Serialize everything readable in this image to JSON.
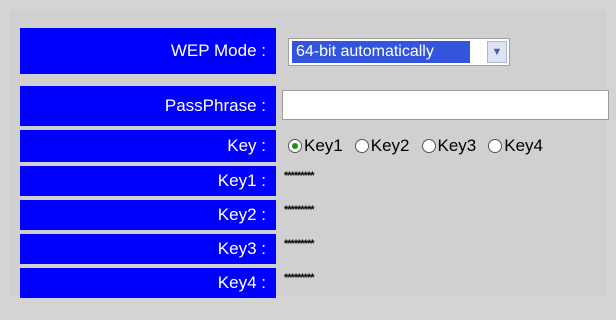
{
  "wep_mode": {
    "label": "WEP Mode :",
    "selected": "64-bit automatically"
  },
  "passphrase": {
    "label": "PassPhrase :",
    "value": ""
  },
  "key_select": {
    "label": "Key :",
    "options": [
      "Key1",
      "Key2",
      "Key3",
      "Key4"
    ],
    "selected": "Key1"
  },
  "keys": [
    {
      "label": "Key1 :",
      "value": "*********"
    },
    {
      "label": "Key2 :",
      "value": "*********"
    },
    {
      "label": "Key3 :",
      "value": "*********"
    },
    {
      "label": "Key4 :",
      "value": "*********"
    }
  ],
  "colors": {
    "label_bg": "#0000ff",
    "selection_bg": "#3355dd",
    "page_bg": "#d4d4d4"
  }
}
